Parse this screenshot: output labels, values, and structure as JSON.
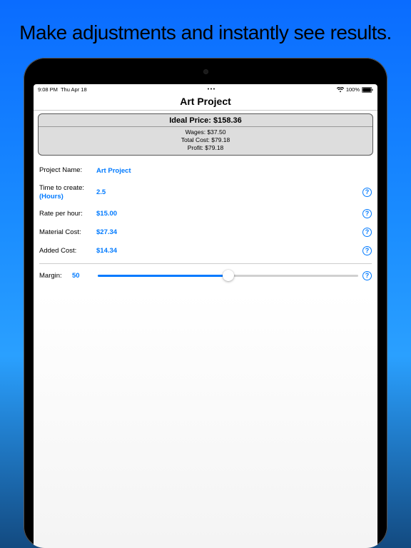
{
  "marketing": {
    "headline": "Make adjustments and instantly see results."
  },
  "status": {
    "time": "9:08 PM",
    "date": "Thu Apr 18",
    "handle": "•••",
    "battery": "100%"
  },
  "nav": {
    "title": "Art Project"
  },
  "summary": {
    "ideal_label": "Ideal Price: $158.36",
    "wages": "Wages: $37.50",
    "total_cost": "Total Cost: $79.18",
    "profit": "Profit: $79.18"
  },
  "form": {
    "project_name": {
      "label": "Project Name:",
      "value": "Art Project"
    },
    "time_to_create": {
      "label": "Time to create:",
      "sublabel": "(Hours)",
      "value": "2.5"
    },
    "rate_per_hour": {
      "label": "Rate per hour:",
      "value": "$15.00"
    },
    "material_cost": {
      "label": "Material Cost:",
      "value": "$27.34"
    },
    "added_cost": {
      "label": "Added Cost:",
      "value": "$14.34"
    },
    "margin": {
      "label": "Margin:",
      "value": "50",
      "percent": 50
    }
  },
  "help_glyph": "?"
}
